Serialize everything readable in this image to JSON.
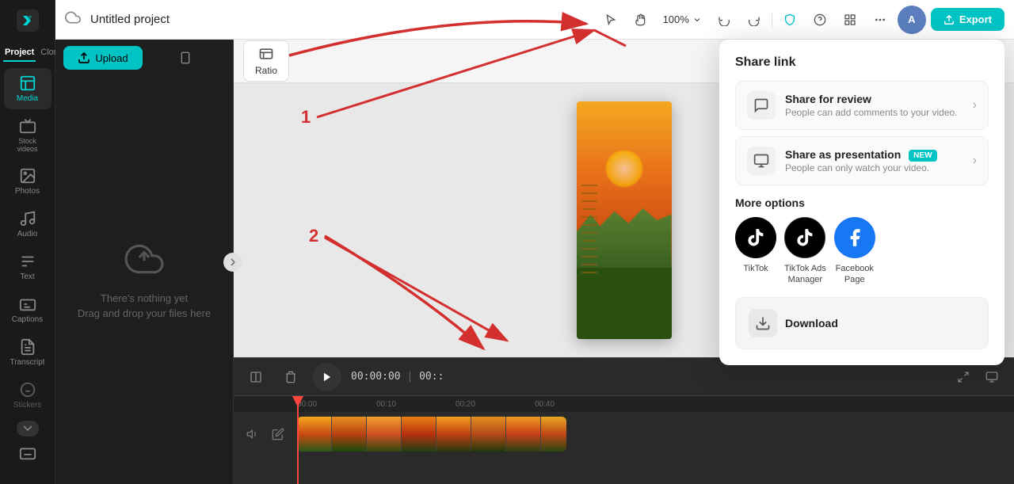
{
  "app": {
    "logo_label": "CapCut",
    "tabs": [
      {
        "id": "project",
        "label": "Project",
        "active": true
      },
      {
        "id": "cloud",
        "label": "Cloud",
        "active": false
      }
    ]
  },
  "topnav": {
    "project_title": "Untitled project",
    "zoom_level": "100%",
    "export_label": "Export",
    "undo_title": "Undo",
    "redo_title": "Redo"
  },
  "sidebar": {
    "items": [
      {
        "id": "media",
        "label": "Media",
        "active": true
      },
      {
        "id": "stock-videos",
        "label": "Stock videos",
        "active": false
      },
      {
        "id": "photos",
        "label": "Photos",
        "active": false
      },
      {
        "id": "audio",
        "label": "Audio",
        "active": false
      },
      {
        "id": "text",
        "label": "Text",
        "active": false
      },
      {
        "id": "captions",
        "label": "Captions",
        "active": false
      },
      {
        "id": "transcript",
        "label": "Transcript",
        "active": false
      },
      {
        "id": "stickers",
        "label": "Stickers",
        "active": false
      }
    ]
  },
  "media_panel": {
    "upload_tab": "Upload",
    "mobile_tab": "Mobile",
    "empty_message_line1": "There's nothing yet",
    "empty_message_line2": "Drag and drop your files here"
  },
  "canvas": {
    "ratio_label": "Ratio"
  },
  "timeline": {
    "play_time": "00:00:00",
    "time_separator": "|",
    "time_secondary": "00::",
    "markers": [
      "00:00",
      "00:10",
      "00:20",
      "00:40"
    ]
  },
  "share_popup": {
    "title": "Share link",
    "review_title": "Share for review",
    "review_desc": "People can add comments to your video.",
    "presentation_title": "Share as presentation",
    "presentation_desc": "People can only watch your video.",
    "presentation_badge": "NEW",
    "more_options_title": "More options",
    "tiktok_label": "TikTok",
    "tiktok_ads_label": "TikTok Ads\nManager",
    "facebook_label": "Facebook\nPage",
    "download_label": "Download"
  },
  "annotations": {
    "arrow1_label": "1",
    "arrow2_label": "2"
  }
}
